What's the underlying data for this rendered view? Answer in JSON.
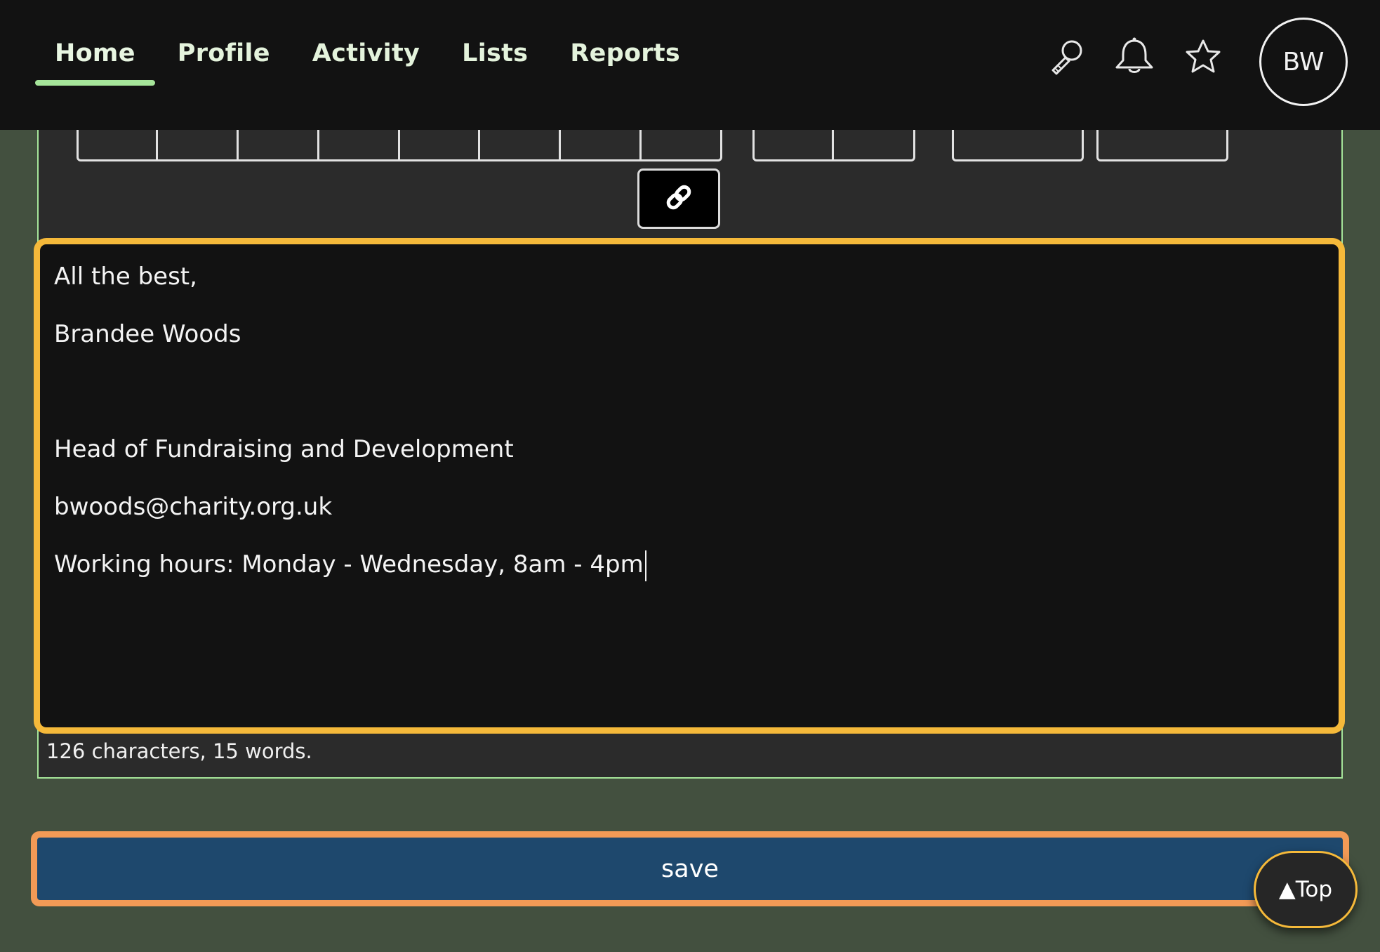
{
  "nav": {
    "items": [
      {
        "label": "Home",
        "active": true
      },
      {
        "label": "Profile",
        "active": false
      },
      {
        "label": "Activity",
        "active": false
      },
      {
        "label": "Lists",
        "active": false
      },
      {
        "label": "Reports",
        "active": false
      }
    ]
  },
  "header": {
    "icons": [
      "search-icon",
      "bell-icon",
      "star-icon"
    ],
    "avatar_initials": "BW"
  },
  "editor": {
    "toolbar_icon": "link-icon",
    "lines": [
      "All the best,",
      "Brandee Woods",
      "",
      "Head of Fundraising and Development",
      "bwoods@charity.org.uk",
      "Working hours: Monday - Wednesday, 8am - 4pm"
    ],
    "counter": "126 characters, 15 words."
  },
  "actions": {
    "save_label": "save",
    "top_label": "▲Top"
  },
  "colors": {
    "header_bg": "#121212",
    "page_bg": "#43503f",
    "accent_green": "#a6e59a",
    "focus_yellow": "#f5b93a",
    "focus_orange": "#f29a56",
    "save_bg": "#1e486d"
  }
}
